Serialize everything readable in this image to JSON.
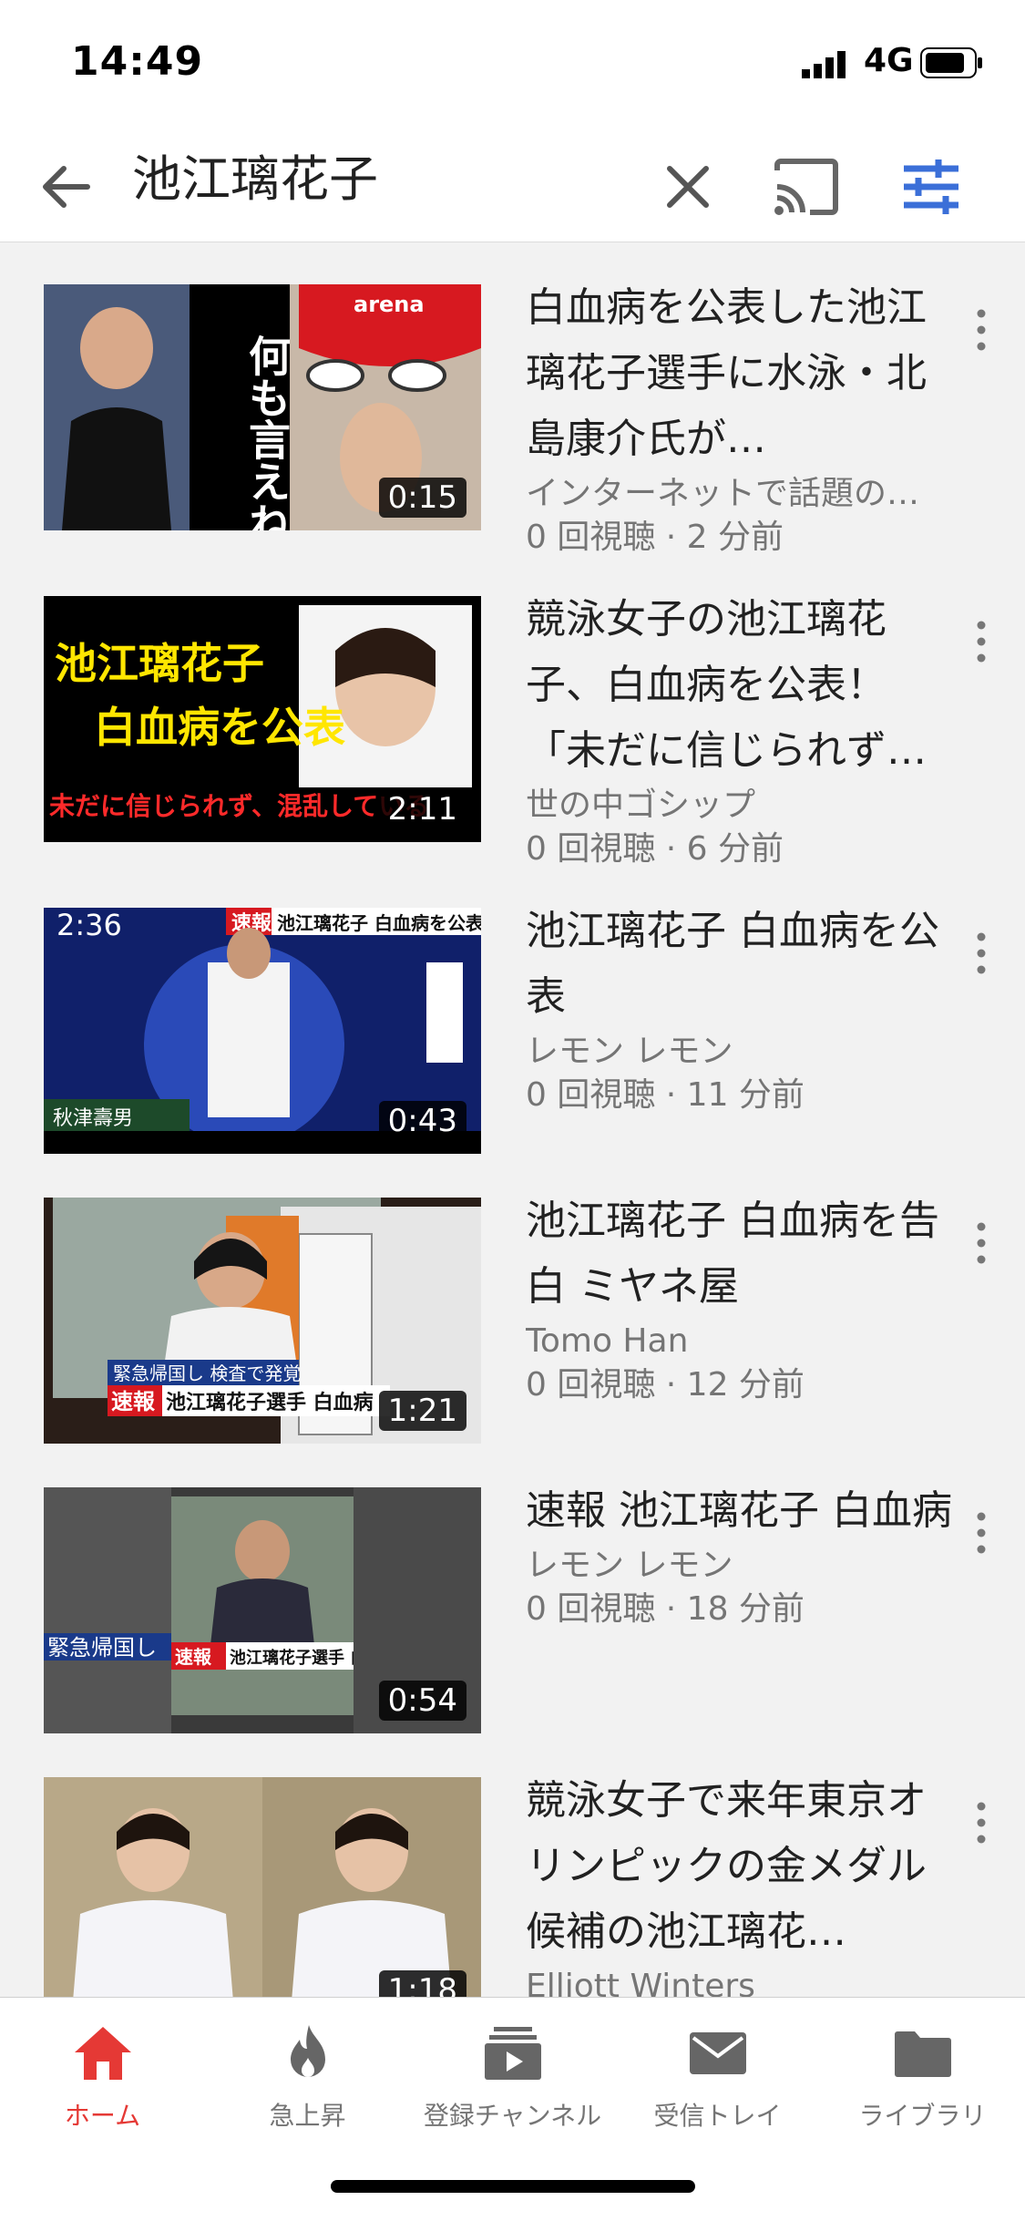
{
  "status": {
    "time": "14:49",
    "network": "4G"
  },
  "search": {
    "query": "池江璃花子"
  },
  "videos": [
    {
      "title": "白血病を公表した池江璃花子選手に水泳・北島康介氏が…",
      "channel": "インターネットで話題の…",
      "meta": "0 回視聴 · 2 分前",
      "duration": "0:15"
    },
    {
      "title": "競泳女子の池江璃花子、白血病を公表！「未だに信じられず…",
      "channel": "世の中ゴシップ",
      "meta": "0 回視聴 · 6 分前",
      "duration": "2:11"
    },
    {
      "title": "池江璃花子 白血病を公表",
      "channel": "レモン レモン",
      "meta": "0 回視聴 · 11 分前",
      "duration": "0:43"
    },
    {
      "title": "池江璃花子 白血病を告白 ミヤネ屋",
      "channel": "Tomo Han",
      "meta": "0 回視聴 · 12 分前",
      "duration": "1:21"
    },
    {
      "title": "速報 池江璃花子 白血病",
      "channel": "レモン レモン",
      "meta": "0 回視聴 · 18 分前",
      "duration": "0:54"
    },
    {
      "title": "競泳女子で来年東京オリンピックの金メダル候補の池江璃花…",
      "channel": "Elliott Winters",
      "meta": "",
      "duration": "1:18"
    }
  ],
  "thumb_text": {
    "t1_vertical": "何も言えねぇ…",
    "t1_cap": "arena",
    "t2_line1": "池江璃花子",
    "t2_line2": "白血病を公表",
    "t2_line3": "未だに信じられず、混乱している",
    "t3_time": "2:36",
    "t3_banner_tag": "速報",
    "t3_banner": "池江璃花子 白血病を公表",
    "t3_name": "秋津壽男",
    "t4_banner_tag": "速報",
    "t4_banner": "池江璃花子選手 白血病",
    "t4_sub": "緊急帰国し 検査で発覚",
    "t5_banner_tag": "速報",
    "t5_banner": "池江璃花子選手 白血病",
    "t5_sub": "緊急帰国し"
  },
  "nav": [
    {
      "label": "ホーム",
      "icon": "home-icon",
      "active": true
    },
    {
      "label": "急上昇",
      "icon": "trending-flame-icon",
      "active": false
    },
    {
      "label": "登録チャンネル",
      "icon": "subscriptions-icon",
      "active": false
    },
    {
      "label": "受信トレイ",
      "icon": "inbox-mail-icon",
      "active": false
    },
    {
      "label": "ライブラリ",
      "icon": "library-folder-icon",
      "active": false
    }
  ],
  "colors": {
    "accent": "#e53935",
    "filter_icon": "#3b6fd8",
    "text_secondary": "#757575",
    "background": "#f2f2f2"
  }
}
